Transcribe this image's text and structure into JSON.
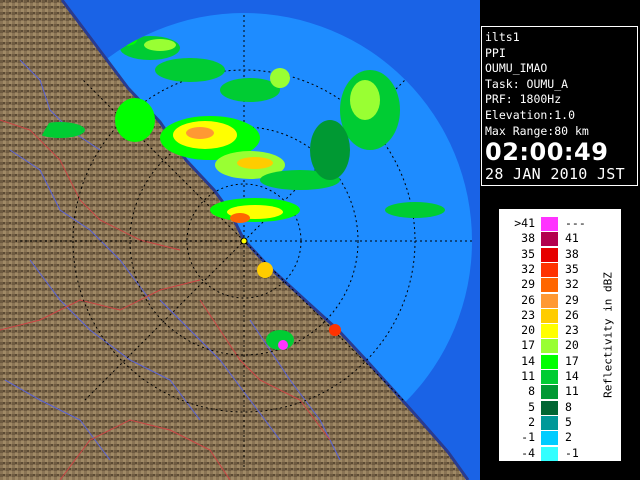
{
  "info": {
    "radar_id": "ilts1",
    "product": "PPI",
    "site": "OUMU_IMAO",
    "task": "Task: OUMU_A",
    "prf": "PRF: 1800Hz",
    "elevation": "Elevation:1.0",
    "max_range": "Max Range:80 km",
    "time": "02:00:49",
    "date": "28 JAN 2010 JST"
  },
  "legend": {
    "axis_title": "Reflectivity in dBZ",
    "bins": [
      {
        "low": ">41",
        "high": "---",
        "color": "#ff33ff"
      },
      {
        "low": "38",
        "high": "41",
        "color": "#b3004d"
      },
      {
        "low": "35",
        "high": "38",
        "color": "#e60000"
      },
      {
        "low": "32",
        "high": "35",
        "color": "#ff3300"
      },
      {
        "low": "29",
        "high": "32",
        "color": "#ff6600"
      },
      {
        "low": "26",
        "high": "29",
        "color": "#ff9933"
      },
      {
        "low": "23",
        "high": "26",
        "color": "#ffcc00"
      },
      {
        "low": "20",
        "high": "23",
        "color": "#ffff00"
      },
      {
        "low": "17",
        "high": "20",
        "color": "#99ff33"
      },
      {
        "low": "14",
        "high": "17",
        "color": "#00ff00"
      },
      {
        "low": "11",
        "high": "14",
        "color": "#00cc33"
      },
      {
        "low": "8",
        "high": "11",
        "color": "#009933"
      },
      {
        "low": "5",
        "high": "8",
        "color": "#006633"
      },
      {
        "low": "2",
        "high": "5",
        "color": "#009999"
      },
      {
        "low": "-1",
        "high": "2",
        "color": "#00ccff"
      },
      {
        "low": "-4",
        "high": "-1",
        "color": "#33ffff"
      }
    ]
  },
  "colors": {
    "background": "#000000",
    "sea": "#1a63e6",
    "radar_coverage": "#1e8cff",
    "land": "#8a7455",
    "range_ring": "#000000"
  }
}
